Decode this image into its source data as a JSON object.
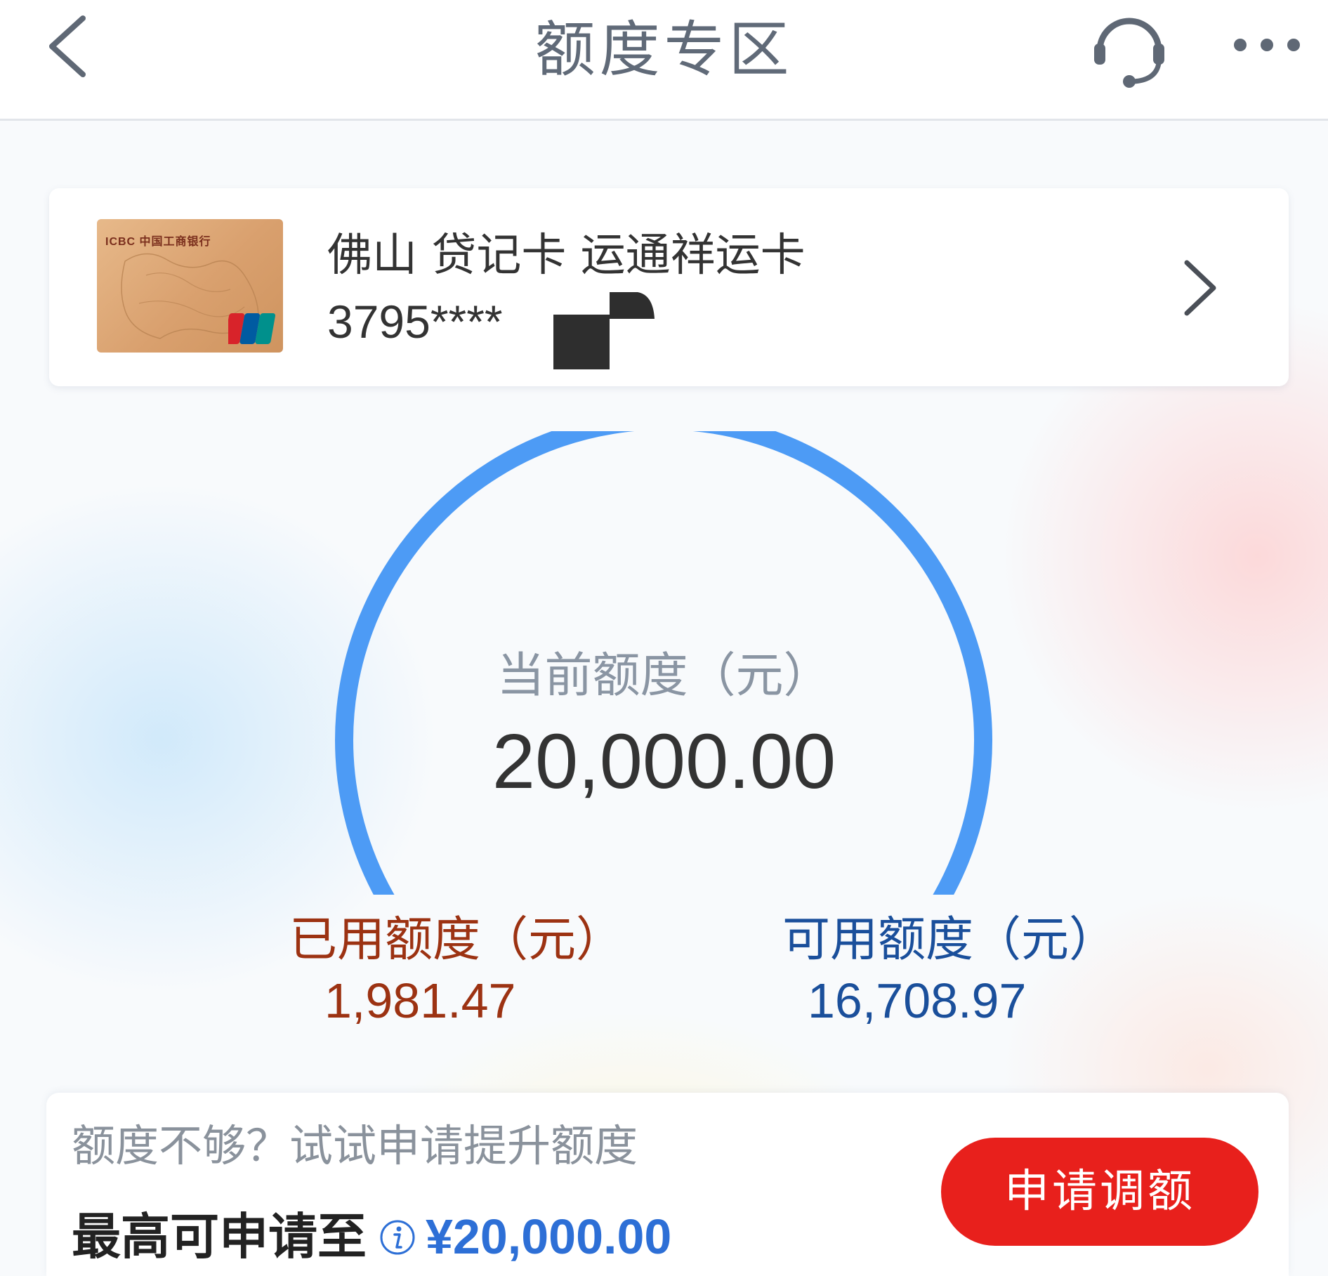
{
  "header": {
    "title": "额度专区",
    "back_icon": "chevron-left-icon",
    "service_icon": "headset-icon",
    "more_icon": "more-dots-icon"
  },
  "card": {
    "name": "佛山 贷记卡 运通祥运卡",
    "number_masked": "3795****",
    "image_brand": "ICBC 中国工商银行",
    "network": "UnionPay"
  },
  "limit": {
    "current_label": "当前额度（元）",
    "current_value": "20,000.00",
    "used_label": "已用额度（元）",
    "used_value": "1,981.47",
    "available_label": "可用额度（元）",
    "available_value": "16,708.97",
    "used_fraction": 0.099
  },
  "promo": {
    "text": "额度不够？试试申请提升额度",
    "max_label": "最高可申请至",
    "max_value": "¥20,000.00",
    "button_label": "申请调额"
  },
  "colors": {
    "accent_blue": "#4d9bf5",
    "used_orange": "#f5521e",
    "used_text": "#9c3212",
    "available_text": "#1a4f9b",
    "button_red": "#e8201c"
  }
}
